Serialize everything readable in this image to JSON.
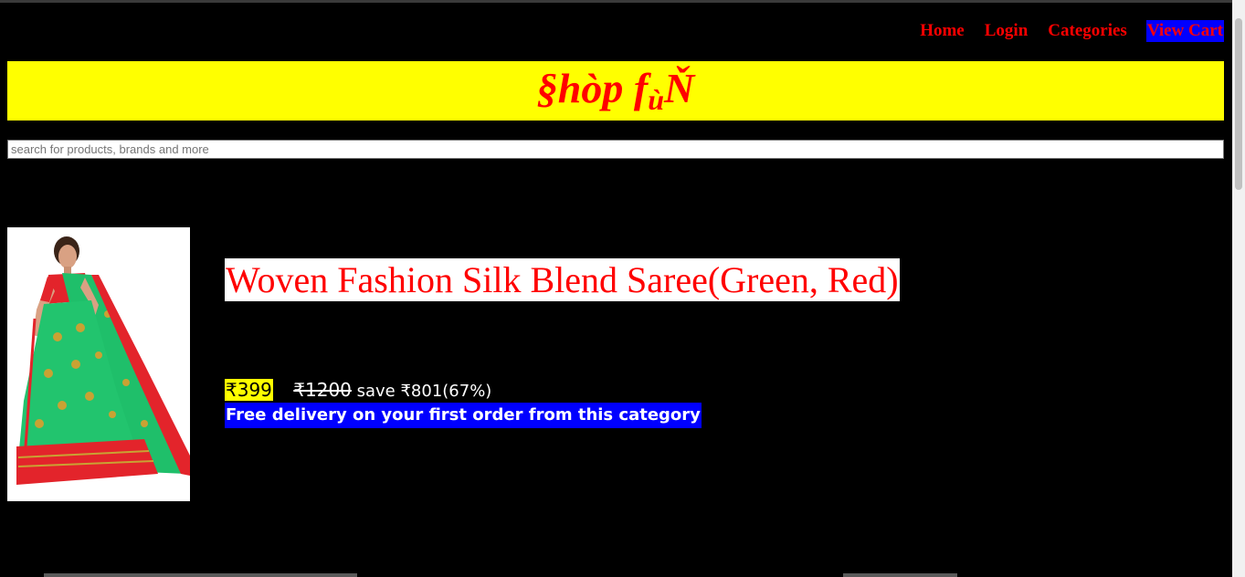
{
  "nav": {
    "home": "Home",
    "login": "Login",
    "categories": "Categories",
    "view_cart": "View Cart"
  },
  "brand": {
    "logo_main": "§hòp f",
    "logo_sub": "ù",
    "logo_end": "Ň"
  },
  "search": {
    "placeholder": "search for products, brands and more",
    "value": ""
  },
  "product": {
    "title": "Woven Fashion Silk Blend Saree(Green, Red)",
    "price": "₹399",
    "mrp": "₹1200",
    "save": " save ₹801(67%)",
    "delivery": "Free delivery on your first order from this category"
  },
  "colors": {
    "background": "#000000",
    "banner": "#ffff00",
    "accent": "#ff0000",
    "cart_bg": "#0000ff"
  }
}
